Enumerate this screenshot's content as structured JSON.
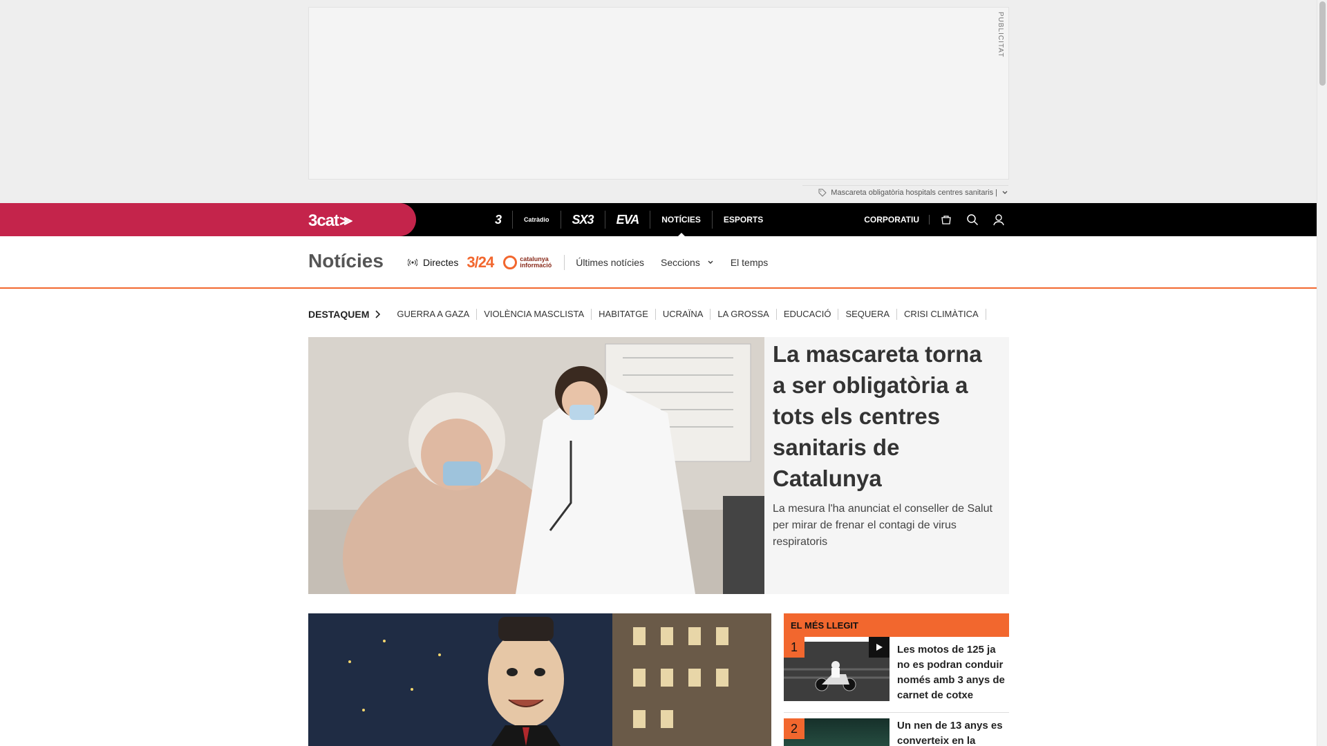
{
  "ad": {
    "label": "PUBLICITAT"
  },
  "topic_strip": {
    "text": "Mascareta obligatòria hospitals centres sanitaris |"
  },
  "topnav": {
    "logo": "3cat",
    "channels": [
      "3",
      "Catràdio",
      "SX3",
      "EVA",
      "NOTÍCIES",
      "ESPORTS"
    ],
    "corporate": "CORPORATIU"
  },
  "section_nav": {
    "title": "Notícies",
    "live": "Directes",
    "logo_324": "3/24",
    "catinfo_line1": "catalunya",
    "catinfo_line2": "informació",
    "links": [
      "Últimes notícies",
      "Seccions",
      "El temps"
    ]
  },
  "highlights": {
    "label": "DESTAQUEM",
    "tags": [
      "GUERRA A GAZA",
      "VIOLÈNCIA MASCLISTA",
      "HABITATGE",
      "UCRAÏNA",
      "LA GROSSA",
      "EDUCACIÓ",
      "SEQUERA",
      "CRISI CLIMÀTICA"
    ]
  },
  "hero": {
    "title": "La mascareta torna a ser obligatòria a tots els centres sanitaris de Catalunya",
    "summary": "La mesura l'ha anunciat el conseller de Salut per mirar de frenar el contagi de virus respiratoris"
  },
  "most_read": {
    "header": "EL MÉS LLEGIT",
    "items": [
      {
        "rank": "1",
        "title": "Les motos de 125 ja no es podran conduir només amb 3 anys de carnet de cotxe"
      },
      {
        "rank": "2",
        "title": "Un nen de 13 anys es converteix en la"
      }
    ]
  },
  "colors": {
    "brand": "#c4244b",
    "accent": "#f2672e",
    "nav_bg": "#000000"
  }
}
